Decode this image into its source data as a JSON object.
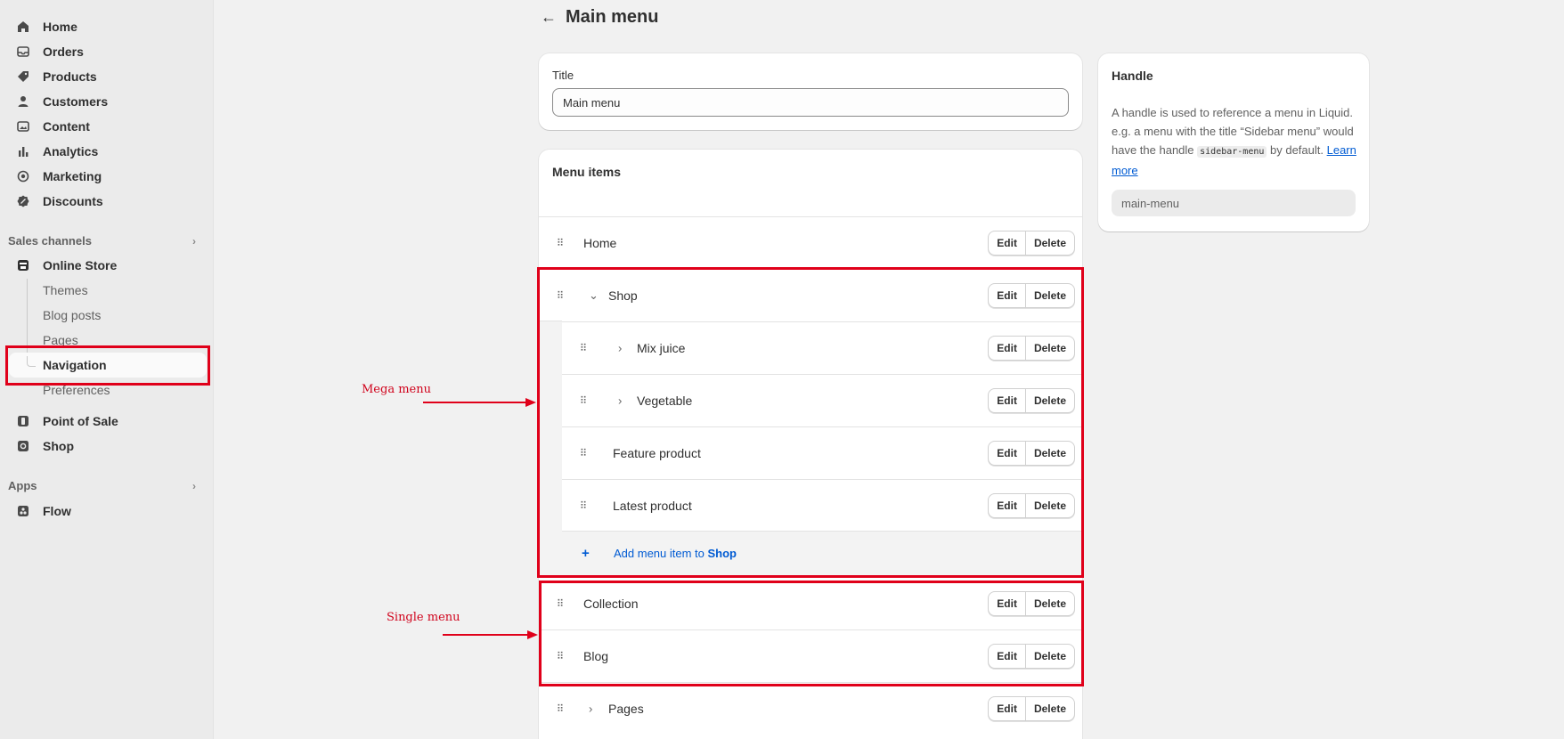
{
  "sidebar": {
    "main_items": [
      {
        "label": "Home",
        "icon": "home-icon"
      },
      {
        "label": "Orders",
        "icon": "inbox-icon"
      },
      {
        "label": "Products",
        "icon": "tag-icon"
      },
      {
        "label": "Customers",
        "icon": "person-icon"
      },
      {
        "label": "Content",
        "icon": "image-icon"
      },
      {
        "label": "Analytics",
        "icon": "bar-chart-icon"
      },
      {
        "label": "Marketing",
        "icon": "target-icon"
      },
      {
        "label": "Discounts",
        "icon": "discount-icon"
      }
    ],
    "sales_channels_label": "Sales channels",
    "online_store": {
      "label": "Online Store",
      "sub_items": [
        "Themes",
        "Blog posts",
        "Pages",
        "Navigation",
        "Preferences"
      ],
      "active": "Navigation"
    },
    "pos_label": "Point of Sale",
    "shop_label": "Shop",
    "apps_label": "Apps",
    "flow_label": "Flow"
  },
  "header": {
    "title": "Main menu"
  },
  "title_card": {
    "label": "Title",
    "value": "Main menu"
  },
  "handle_card": {
    "title": "Handle",
    "desc_1": "A handle is used to reference a menu in Liquid. e.g. a menu with the title “Sidebar menu” would have the handle ",
    "code": "sidebar-menu",
    "desc_2": " by default. ",
    "learn_more": "Learn more",
    "value": "main-menu"
  },
  "menu_card": {
    "title": "Menu items",
    "edit_label": "Edit",
    "delete_label": "Delete",
    "items": {
      "home": "Home",
      "shop": "Shop",
      "mix_juice": "Mix juice",
      "vegetable": "Vegetable",
      "feature_product": "Feature product",
      "latest_product": "Latest product",
      "collection": "Collection",
      "blog": "Blog",
      "pages": "Pages"
    },
    "add_prefix": "Add menu item to ",
    "add_target": "Shop"
  },
  "annotations": {
    "mega_menu": "Mega menu",
    "single_menu": "Single menu",
    "color": "#e0001a"
  }
}
